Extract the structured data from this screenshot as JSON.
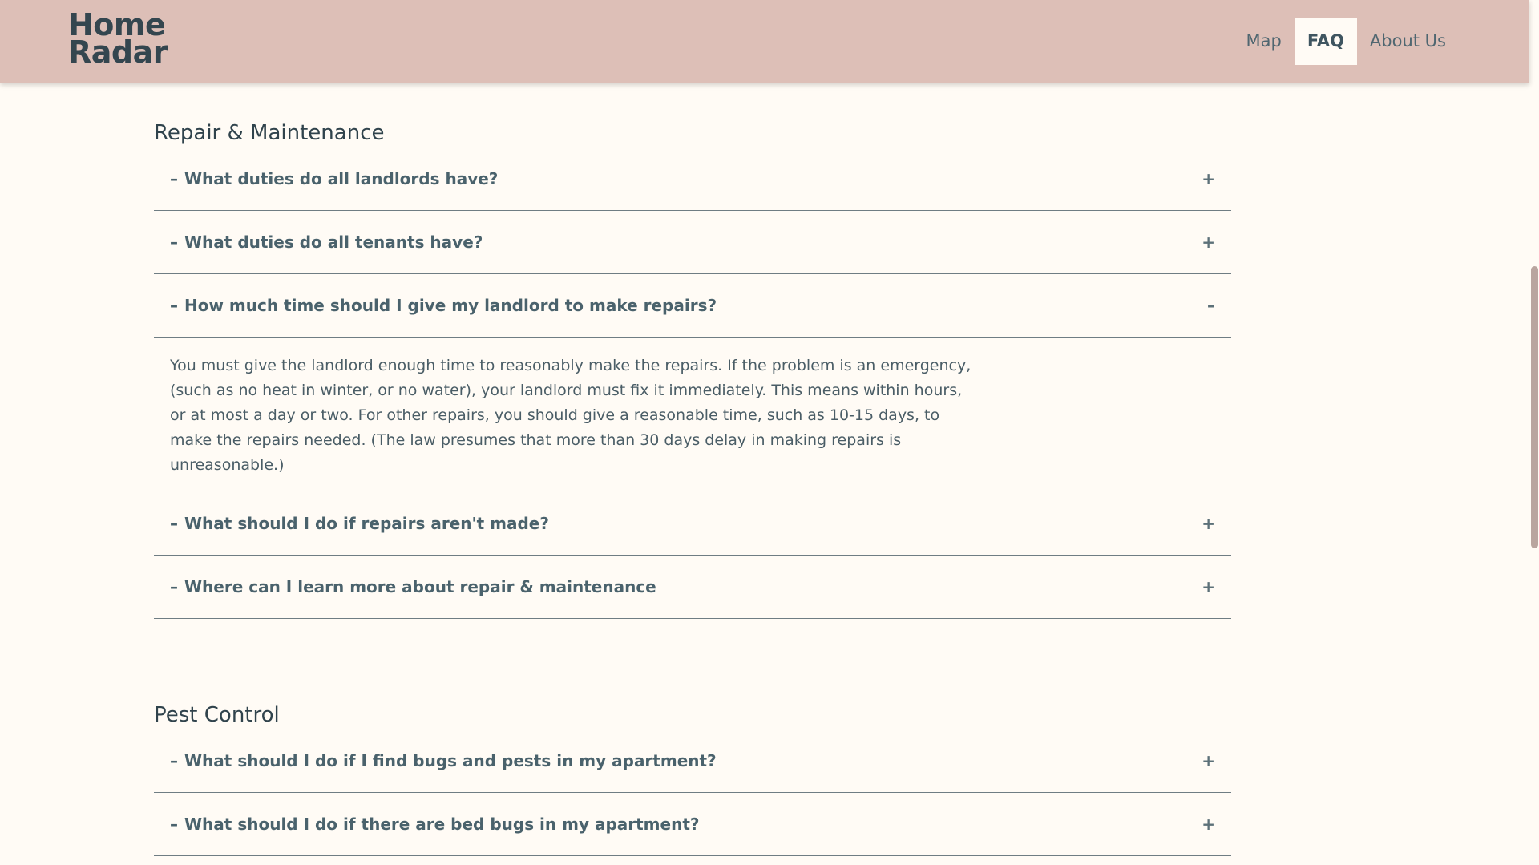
{
  "header": {
    "logo_line1": "Home",
    "logo_line2": "Radar",
    "nav": [
      {
        "label": "Map"
      },
      {
        "label": "FAQ"
      },
      {
        "label": "About Us"
      }
    ]
  },
  "sections": [
    {
      "title": "Repair & Maintenance",
      "items": [
        {
          "question": "What duties do all landlords have?",
          "toggle": "+"
        },
        {
          "question": "What duties do all tenants have?",
          "toggle": "+"
        },
        {
          "question": "How much time should I give my landlord to make repairs?",
          "toggle": "–",
          "answer": "You must give the landlord enough time to reasonably make the repairs. If the problem is an emergency, (such as no heat in winter, or no water), your landlord must fix it immediately. This means within hours, or at most a day or two. For other repairs, you should give a reasonable time, such as 10-15 days, to make the repairs needed. (The law presumes that more than 30 days delay in making repairs is unreasonable.)"
        },
        {
          "question": "What should I do if repairs aren't made?",
          "toggle": "+"
        },
        {
          "question": "Where can I learn more about repair & maintenance",
          "toggle": "+"
        }
      ]
    },
    {
      "title": "Pest Control",
      "items": [
        {
          "question": "What should I do if I find bugs and pests in my apartment?",
          "toggle": "+"
        },
        {
          "question": "What should I do if there are bed bugs in my apartment?",
          "toggle": "+"
        }
      ]
    }
  ],
  "dash": "–",
  "colors": {
    "header_bg": "#ddbfb7",
    "page_bg": "#fffbf5",
    "text": "#4a626c"
  }
}
